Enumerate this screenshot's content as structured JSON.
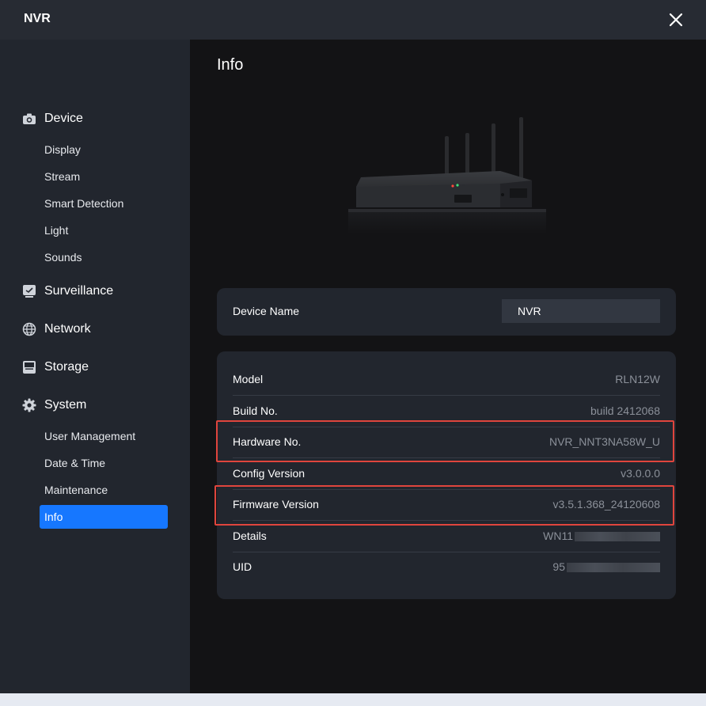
{
  "window": {
    "title": "NVR"
  },
  "sidebar": {
    "sections": [
      {
        "label": "Device",
        "icon": "camera-icon",
        "items": [
          "Display",
          "Stream",
          "Smart Detection",
          "Light",
          "Sounds"
        ]
      },
      {
        "label": "Surveillance",
        "icon": "monitor-icon",
        "items": []
      },
      {
        "label": "Network",
        "icon": "globe-icon",
        "items": []
      },
      {
        "label": "Storage",
        "icon": "storage-icon",
        "items": []
      },
      {
        "label": "System",
        "icon": "gear-icon",
        "items": [
          "User Management",
          "Date & Time",
          "Maintenance",
          "Info"
        ]
      }
    ],
    "active_item": "Info"
  },
  "main": {
    "title": "Info",
    "device_name": {
      "label": "Device Name",
      "value": "NVR"
    },
    "info_rows": [
      {
        "label": "Model",
        "value": "RLN12W"
      },
      {
        "label": "Build No.",
        "value": "build 2412068"
      },
      {
        "label": "Hardware No.",
        "value": "NVR_NNT3NA58W_U"
      },
      {
        "label": "Config Version",
        "value": "v3.0.0.0"
      },
      {
        "label": "Firmware Version",
        "value": "v3.5.1.368_24120608"
      },
      {
        "label": "Details",
        "value": "WN11"
      },
      {
        "label": "UID",
        "value": "95"
      }
    ]
  },
  "colors": {
    "accent": "#1677ff",
    "highlight": "#e0453d",
    "sidebar_bg": "#22262e",
    "content_bg": "#131315"
  }
}
